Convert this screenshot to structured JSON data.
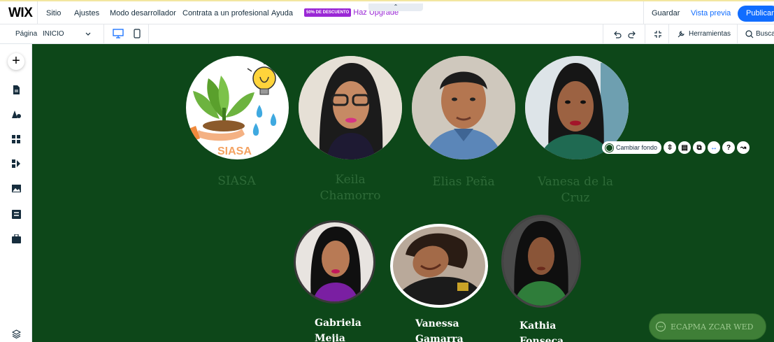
{
  "topbar": {
    "logo": "WIX",
    "menu": [
      "Sitio",
      "Ajustes",
      "Modo desarrollador",
      "Contrata a un profesional",
      "Ayuda"
    ],
    "promo_badge": "50% DE DESCUENTO",
    "promo_link": "Haz Upgrade",
    "collapse_glyph": "⌃",
    "save": "Guardar",
    "preview": "Vista previa",
    "publish": "Publicar"
  },
  "subbar": {
    "page_label": "Página",
    "page_value": "INICIO",
    "tools_label": "Herramientas",
    "search_label": "Busca"
  },
  "leftbar": {
    "add_glyph": "+",
    "icons": [
      "pages-icon",
      "design-icon",
      "apps-icon",
      "business-icon",
      "media-icon",
      "cms-icon",
      "portfolio-icon",
      "layers-icon"
    ]
  },
  "canvas": {
    "bg_color": "#0d4719",
    "logo_text": "SIASA",
    "row1_names": [
      "SIASA",
      "Keila Chamorro",
      "Elias Peña",
      "Vanesa de la Cruz"
    ],
    "row2_names": [
      "Gabriela Mejia",
      "Vanessa Gamarra",
      "Kathia Fonseca"
    ]
  },
  "floating_toolbar": {
    "change_bg": "Cambiar fondo"
  },
  "chat": {
    "label": "ECAPMA ZCAR WED"
  },
  "colors": {
    "accent": "#116dff",
    "promo": "#9a27d5"
  }
}
